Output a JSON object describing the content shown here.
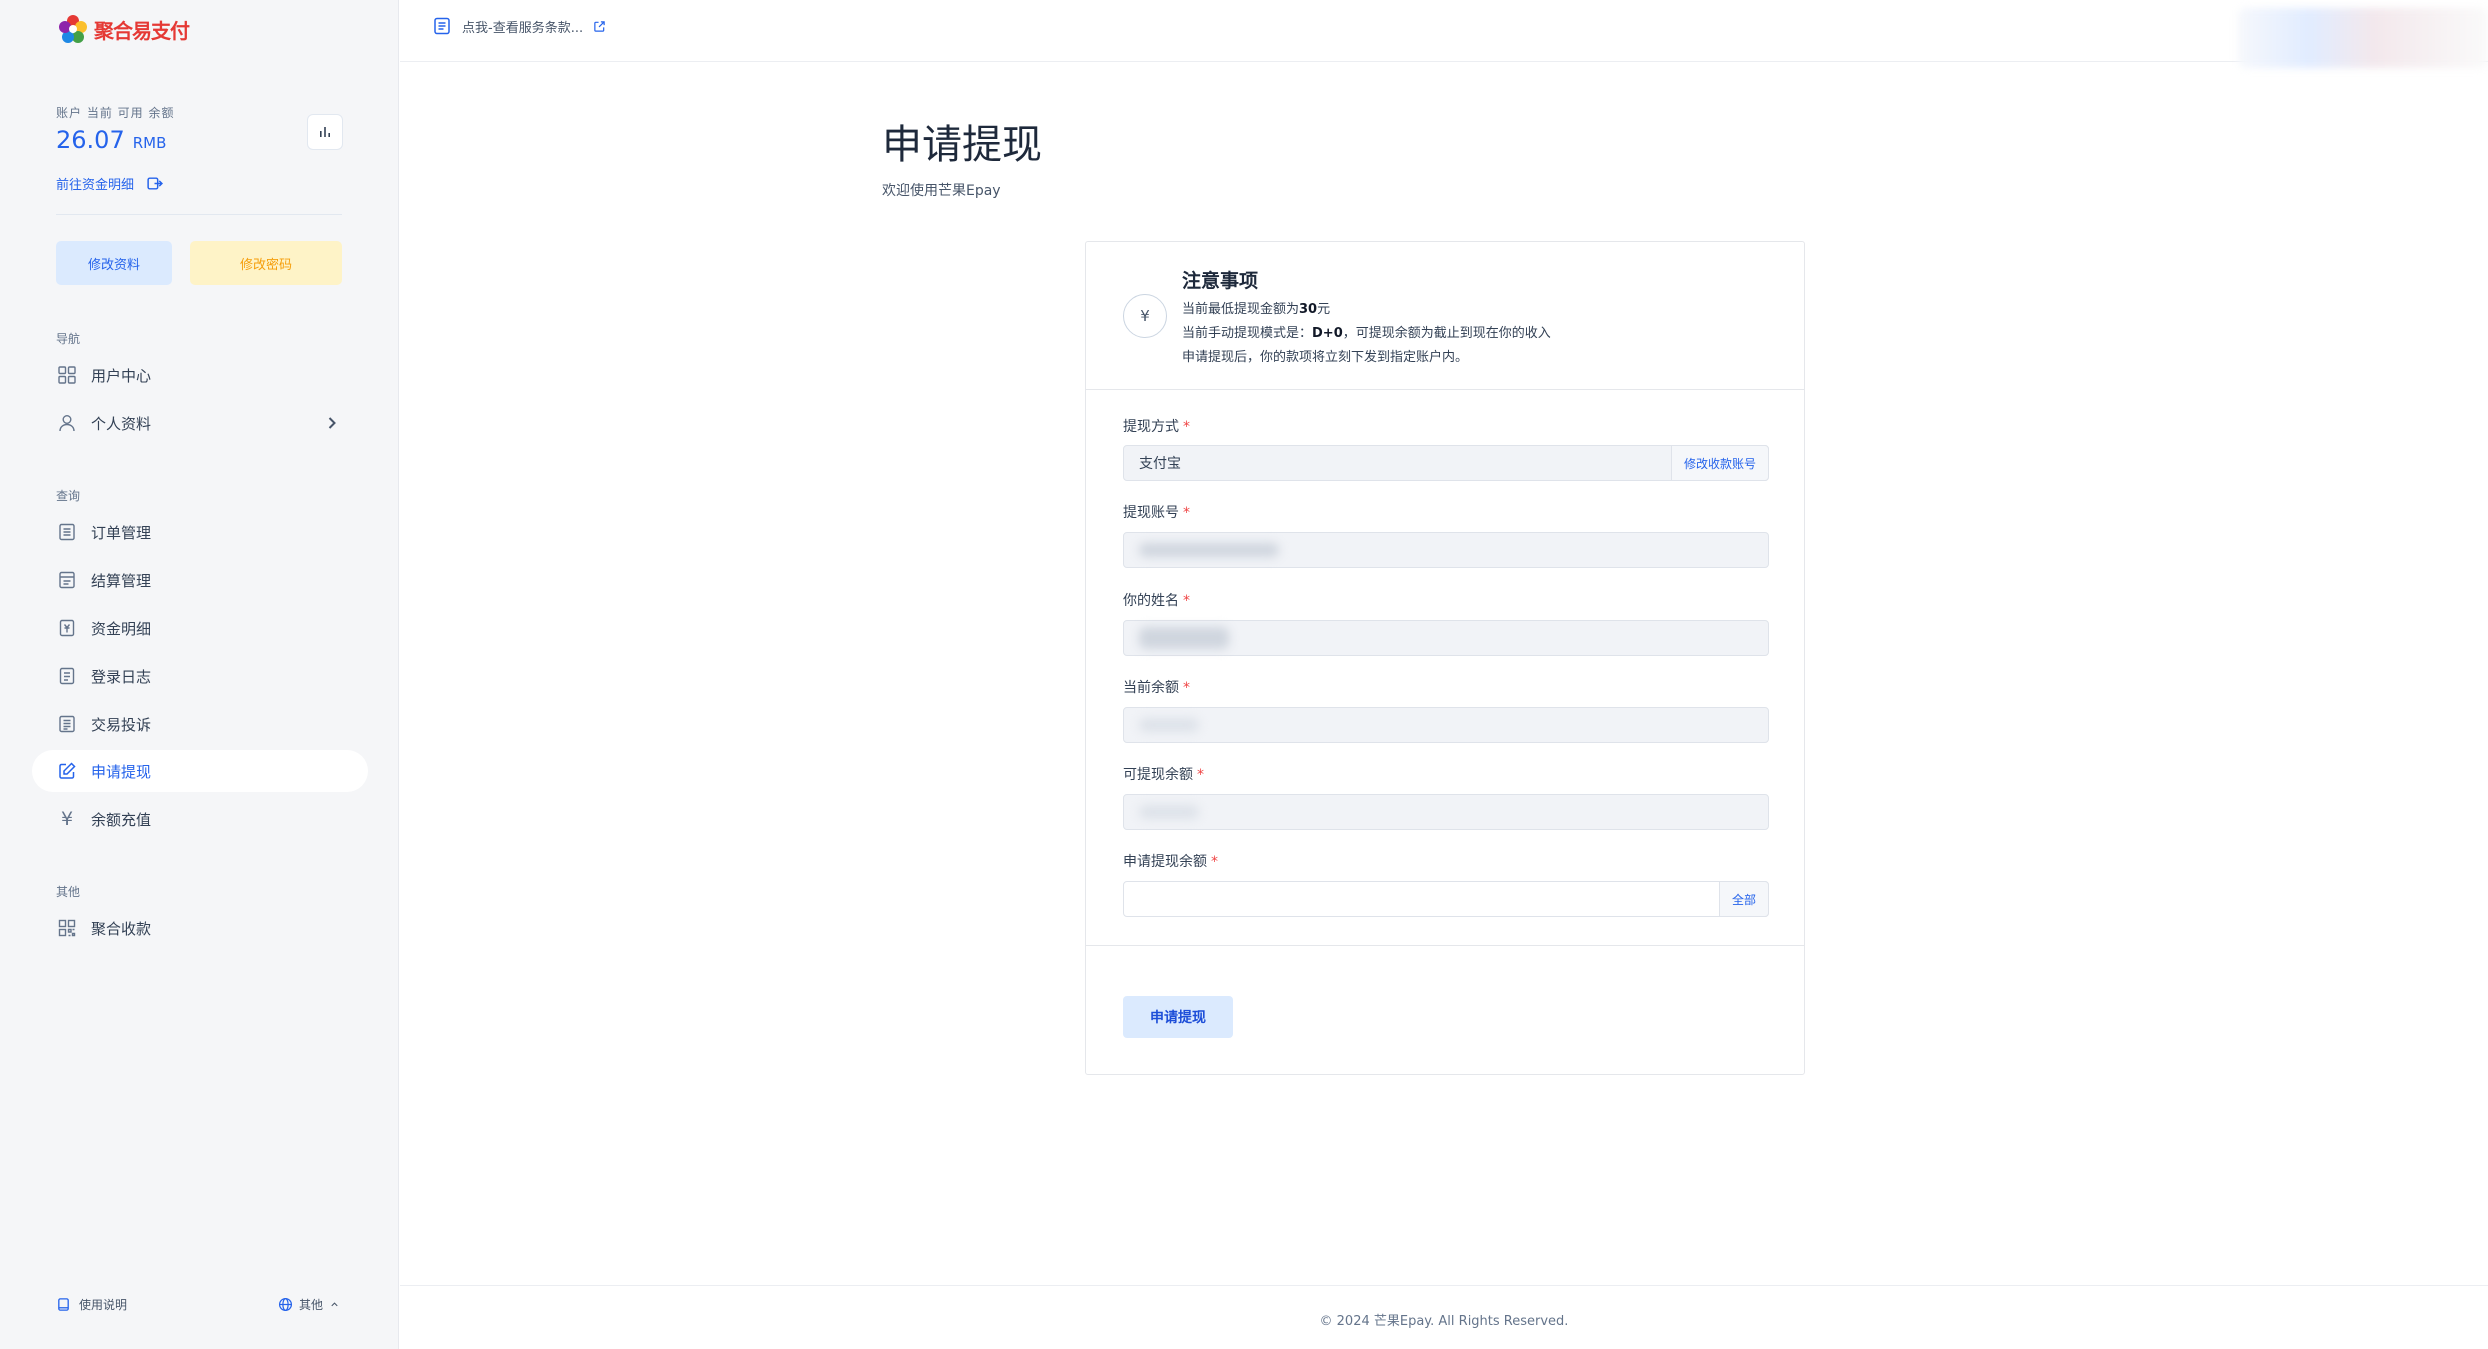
{
  "sidebar": {
    "logo_text": "聚合易支付",
    "balance_label": "账户 当前 可用 余额",
    "balance_amount": "26.07",
    "balance_unit": "RMB",
    "funds_link": "前往资金明细",
    "edit_profile_btn": "修改资料",
    "edit_password_btn": "修改密码",
    "sections": {
      "nav": "导航",
      "query": "查询",
      "other": "其他"
    },
    "items": {
      "user_center": "用户中心",
      "profile": "个人资料",
      "orders": "订单管理",
      "settlement": "结算管理",
      "funds": "资金明细",
      "login_log": "登录日志",
      "complaints": "交易投诉",
      "withdraw": "申请提现",
      "recharge": "余额充值",
      "aggregate": "聚合收款"
    },
    "footer_help": "使用说明",
    "footer_lang": "其他"
  },
  "topbar": {
    "notice": "点我-查看服务条款..."
  },
  "main": {
    "title": "申请提现",
    "subtitle": "欢迎使用芒果Epay",
    "notice_title": "注意事项",
    "notice_line1_prefix": "当前最低提现金额为",
    "notice_line1_amount": "30",
    "notice_line1_suffix": "元",
    "notice_line2_prefix": "当前手动提现模式是：",
    "notice_line2_mode": "D+0",
    "notice_line2_suffix": "，可提现余额为截止到现在你的收入",
    "notice_line3": "申请提现后，你的款项将立刻下发到指定账户内。",
    "fields": {
      "method_label": "提现方式",
      "method_value": "支付宝",
      "method_action": "修改收款账号",
      "account_label": "提现账号",
      "name_label": "你的姓名",
      "balance_label": "当前余额",
      "withdrawable_label": "可提现余额",
      "request_label": "申请提现余额",
      "request_action": "全部",
      "required_mark": "*"
    },
    "submit": "申请提现"
  },
  "footer": {
    "copyright": "© 2024 芒果Epay. All Rights Reserved."
  },
  "colors": {
    "accent": "#2563eb",
    "warning": "#f59e0b",
    "required": "#ef4444"
  }
}
